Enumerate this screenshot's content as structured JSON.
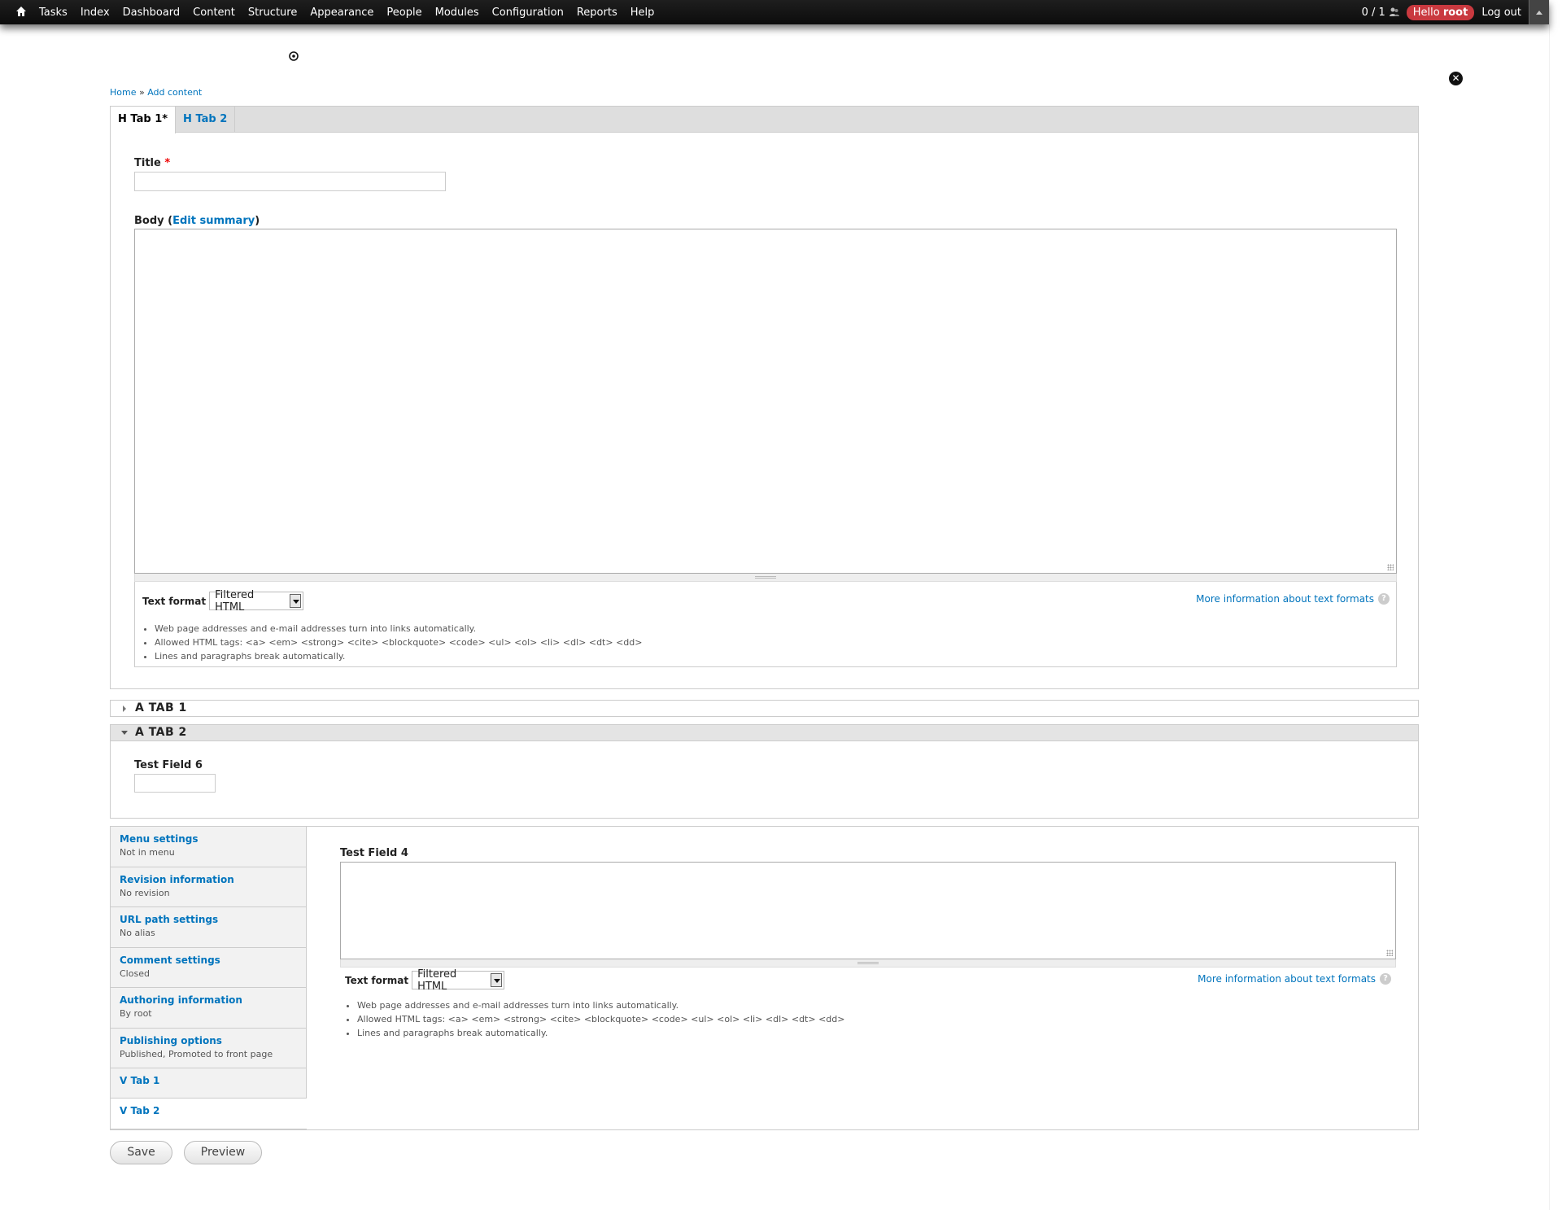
{
  "toolbar": {
    "menu": [
      "Tasks",
      "Index",
      "Dashboard",
      "Content",
      "Structure",
      "Appearance",
      "People",
      "Modules",
      "Configuration",
      "Reports",
      "Help"
    ],
    "counter": "0 / 1",
    "hello_prefix": "Hello",
    "hello_user": "root",
    "logout": "Log out"
  },
  "breadcrumb": {
    "home": "Home",
    "sep": "»",
    "current": "Add content"
  },
  "htabs": {
    "tab1": "H Tab 1*",
    "tab2": "H Tab 2"
  },
  "title_field": {
    "label": "Title",
    "required_mark": "*",
    "value": ""
  },
  "body_field": {
    "label_prefix": "Body (",
    "edit_summary": "Edit summary",
    "label_suffix": ")",
    "value": ""
  },
  "text_format": {
    "label": "Text format",
    "selected": "Filtered HTML",
    "more_info": "More information about text formats",
    "tips": [
      "Web page addresses and e-mail addresses turn into links automatically.",
      "Allowed HTML tags: <a> <em> <strong> <cite> <blockquote> <code> <ul> <ol> <li> <dl> <dt> <dd>",
      "Lines and paragraphs break automatically."
    ]
  },
  "accordion": {
    "tab1": "A TAB 1",
    "tab2": "A TAB 2",
    "test_field_6_label": "Test Field 6"
  },
  "vtabs": {
    "items": [
      {
        "title": "Menu settings",
        "summary": "Not in menu"
      },
      {
        "title": "Revision information",
        "summary": "No revision"
      },
      {
        "title": "URL path settings",
        "summary": "No alias"
      },
      {
        "title": "Comment settings",
        "summary": "Closed"
      },
      {
        "title": "Authoring information",
        "summary": "By root"
      },
      {
        "title": "Publishing options",
        "summary": "Published, Promoted to front page"
      },
      {
        "title": "V Tab 1"
      },
      {
        "title": "V Tab 2"
      }
    ],
    "test_field_4_label": "Test Field 4"
  },
  "buttons": {
    "save": "Save",
    "preview": "Preview"
  }
}
